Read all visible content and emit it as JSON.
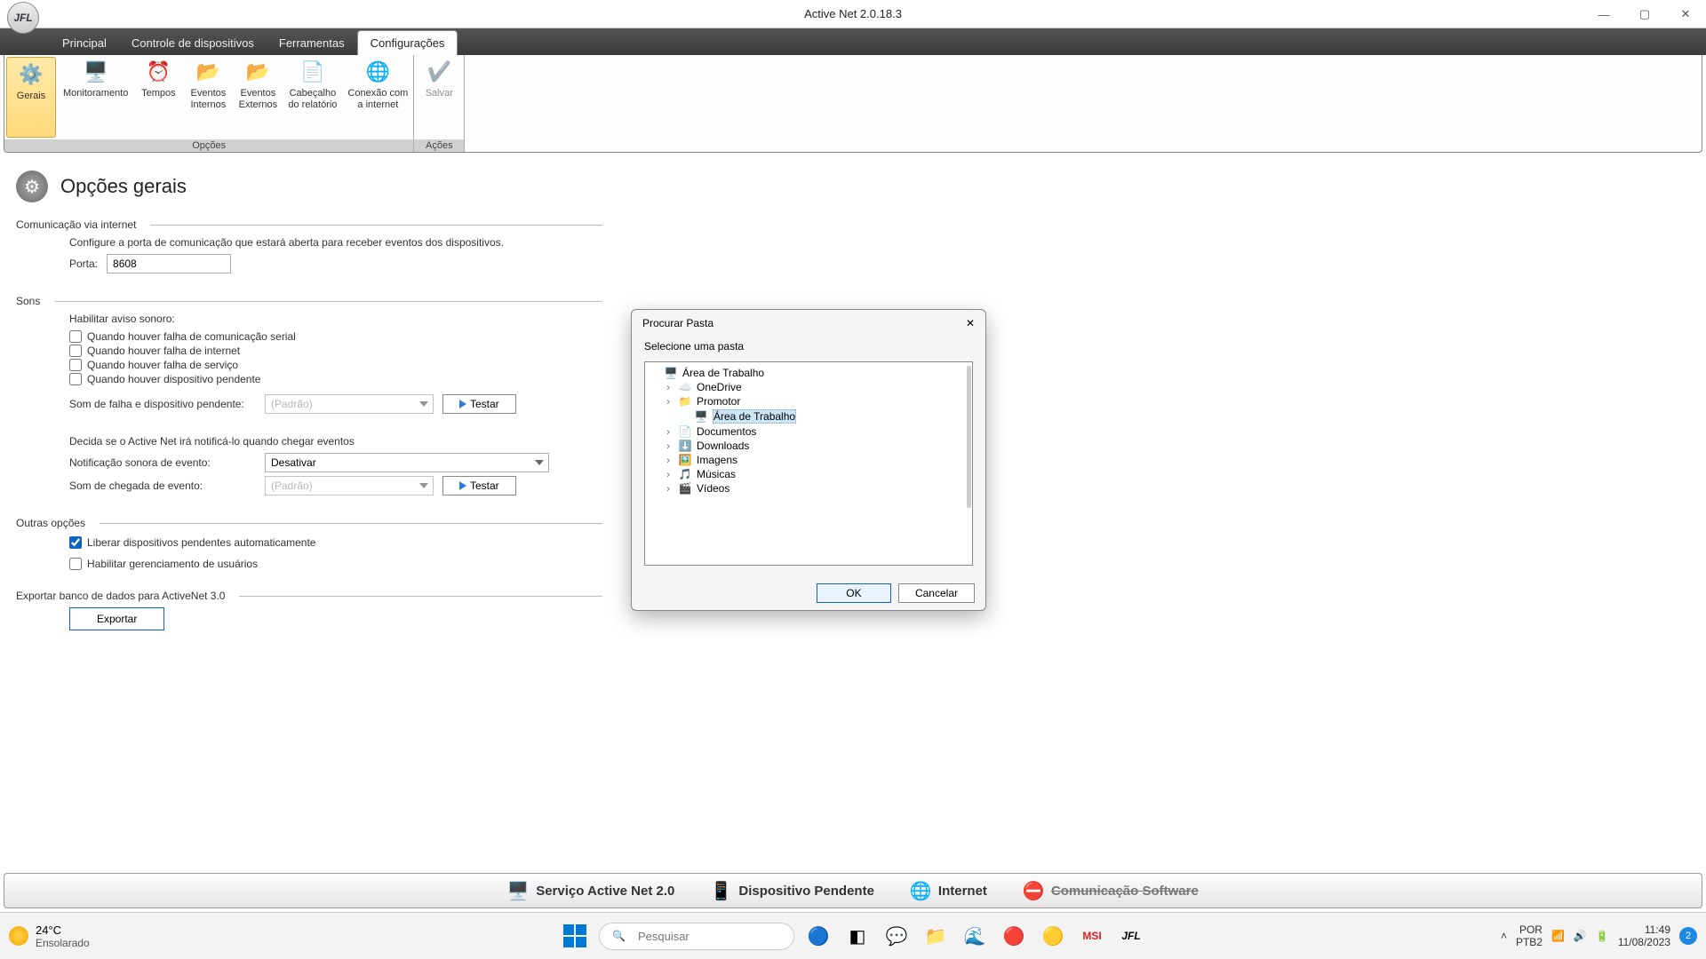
{
  "title": "Active Net 2.0.18.3",
  "menu": {
    "principal": "Principal",
    "controle": "Controle de dispositivos",
    "ferramentas": "Ferramentas",
    "config": "Configurações"
  },
  "ribbon": {
    "gerais": "Gerais",
    "monit": "Monitoramento",
    "tempos": "Tempos",
    "evint": "Eventos\nInternos",
    "evext": "Eventos\nExternos",
    "cab": "Cabeçalho\ndo relatório",
    "conex": "Conexão com\na internet",
    "salvar": "Salvar",
    "grp_opcoes": "Opções",
    "grp_acoes": "Ações"
  },
  "page": {
    "h1": "Opções gerais",
    "s1": {
      "legend": "Comunicação via internet",
      "desc": "Configure a porta de comunicação que estará aberta para receber eventos dos dispositivos.",
      "porta_label": "Porta:",
      "porta": "8608"
    },
    "s2": {
      "legend": "Sons",
      "hab": "Habilitar aviso sonoro:",
      "c1": "Quando houver falha de comunicação serial",
      "c2": "Quando houver falha de internet",
      "c3": "Quando houver falha de serviço",
      "c4": "Quando houver dispositivo pendente",
      "som_label": "Som de falha e dispositivo pendente:",
      "padrao": "(Padrão)",
      "testar": "Testar",
      "decida": "Decida se o Active Net irá notificá-lo quando chegar eventos",
      "notif_label": "Notificação sonora de evento:",
      "desativar": "Desativar",
      "som_cheg": "Som de chegada de evento:"
    },
    "s3": {
      "legend": "Outras opções",
      "c1": "Liberar dispositivos pendentes automaticamente",
      "c2": "Habilitar gerenciamento de usuários"
    },
    "s4": {
      "legend": "Exportar banco de dados para ActiveNet 3.0",
      "btn": "Exportar"
    }
  },
  "status": {
    "serv": "Serviço Active Net 2.0",
    "disp": "Dispositivo Pendente",
    "int": "Internet",
    "com": "Comunicação Software"
  },
  "dialog": {
    "title": "Procurar Pasta",
    "hint": "Selecione uma pasta",
    "nodes": [
      {
        "label": "Área de Trabalho",
        "icon": "🖥️",
        "indent": 0,
        "exp": ""
      },
      {
        "label": "OneDrive",
        "icon": "☁️",
        "indent": 1,
        "exp": "›"
      },
      {
        "label": "Promotor",
        "icon": "📁",
        "indent": 1,
        "exp": "›"
      },
      {
        "label": "Área de Trabalho",
        "icon": "🖥️",
        "indent": 2,
        "exp": "",
        "selected": true
      },
      {
        "label": "Documentos",
        "icon": "📄",
        "indent": 1,
        "exp": "›"
      },
      {
        "label": "Downloads",
        "icon": "⬇️",
        "indent": 1,
        "exp": "›"
      },
      {
        "label": "Imagens",
        "icon": "🖼️",
        "indent": 1,
        "exp": "›"
      },
      {
        "label": "Músicas",
        "icon": "🎵",
        "indent": 1,
        "exp": "›"
      },
      {
        "label": "Vídeos",
        "icon": "🎬",
        "indent": 1,
        "exp": "›"
      }
    ],
    "ok": "OK",
    "cancel": "Cancelar"
  },
  "taskbar": {
    "temp": "24°C",
    "cond": "Ensolarado",
    "search": "Pesquisar",
    "lang1": "POR",
    "lang2": "PTB2",
    "time": "11:49",
    "date": "11/08/2023",
    "notif": "2"
  }
}
